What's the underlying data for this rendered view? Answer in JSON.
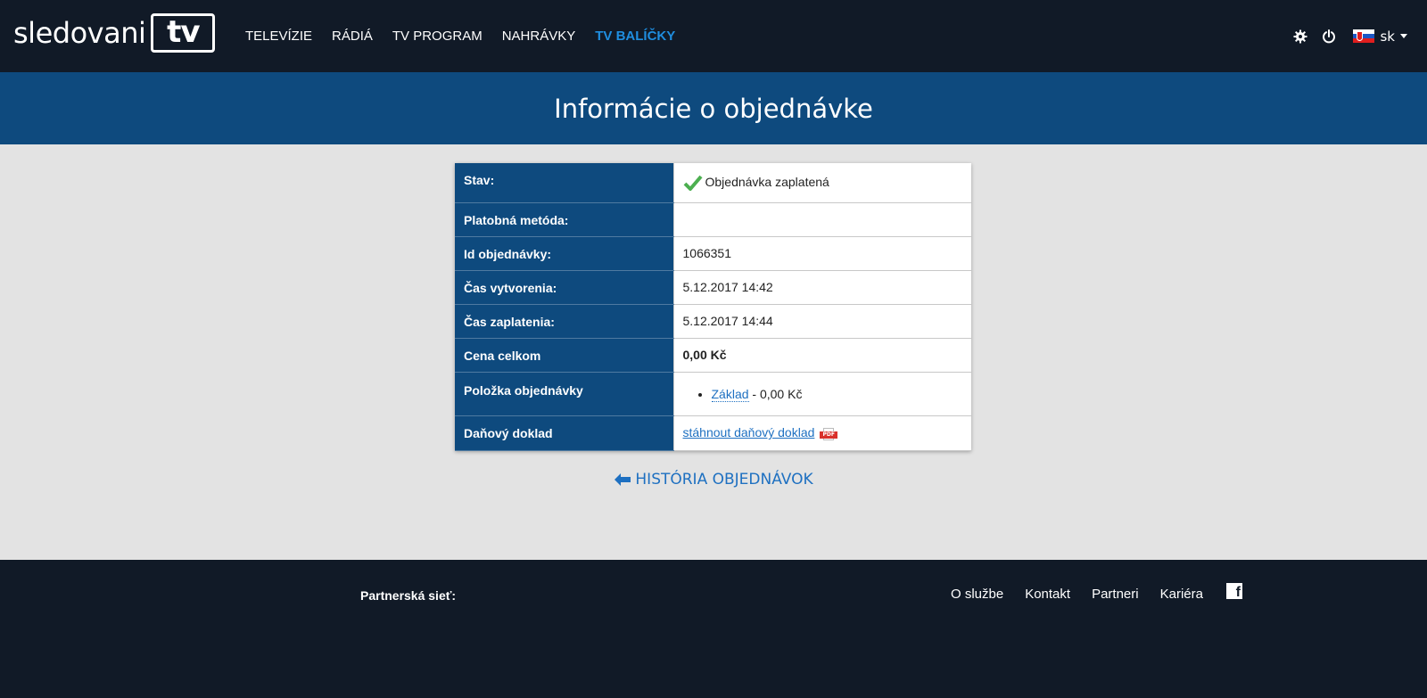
{
  "logo": {
    "text": "sledovani",
    "tv": "tv"
  },
  "nav": {
    "items": [
      {
        "label": "TELEVÍZIE"
      },
      {
        "label": "RÁDIÁ"
      },
      {
        "label": "TV PROGRAM"
      },
      {
        "label": "NAHRÁVKY"
      },
      {
        "label": "TV BALÍČKY",
        "active": true
      }
    ]
  },
  "topbar": {
    "settings_icon": "gear-icon",
    "power_icon": "power-icon",
    "language": "sk"
  },
  "page": {
    "title": "Informácie o objednávke"
  },
  "order": {
    "rows": [
      {
        "label": "Stav:",
        "value": "Objednávka zaplatená"
      },
      {
        "label": "Platobná metóda:",
        "value": ""
      },
      {
        "label": "Id objednávky:",
        "value": "1066351"
      },
      {
        "label": "Čas vytvorenia:",
        "value": "5.12.2017 14:42"
      },
      {
        "label": "Čas zaplatenia:",
        "value": "5.12.2017 14:44"
      },
      {
        "label": "Cena celkom",
        "value": "0,00 Kč"
      },
      {
        "label": "Položka objednávky",
        "item_name": "Základ",
        "item_price": " - 0,00 Kč"
      },
      {
        "label": "Daňový doklad",
        "value": "stáhnout daňový doklad"
      }
    ]
  },
  "back": {
    "label": "HISTÓRIA OBJEDNÁVOK"
  },
  "footer": {
    "partner_label": "Partnerská sieť:",
    "links": [
      {
        "label": "O službe"
      },
      {
        "label": "Kontakt"
      },
      {
        "label": "Partneri"
      },
      {
        "label": "Kariéra"
      }
    ],
    "social_icon": "facebook-icon"
  },
  "colors": {
    "topbar_bg": "#111a27",
    "title_band_bg": "#0e4a7e",
    "accent": "#1f8ee0",
    "link": "#1e70c1",
    "success": "#4caf50"
  }
}
